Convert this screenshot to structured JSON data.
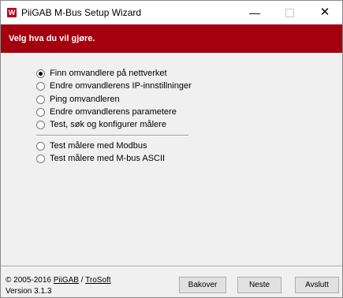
{
  "window": {
    "title": "PiiGAB M-Bus Setup Wizard",
    "app_icon_letter": "W",
    "minimize_glyph": "—",
    "close_glyph": "✕"
  },
  "banner": {
    "text": "Velg hva du vil gjøre.",
    "color": "#a5000e"
  },
  "options_group1": [
    {
      "label": "Finn omvandlere på nettverket",
      "selected": true
    },
    {
      "label": "Endre omvandlerens IP-innstillninger",
      "selected": false
    },
    {
      "label": "Ping omvandleren",
      "selected": false
    },
    {
      "label": "Endre omvandlerens parametere",
      "selected": false
    },
    {
      "label": "Test, søk og konfigurer målere",
      "selected": false
    }
  ],
  "options_group2": [
    {
      "label": "Test målere med Modbus",
      "selected": false
    },
    {
      "label": "Test målere med M-bus ASCII",
      "selected": false
    }
  ],
  "footer": {
    "copyright_prefix": "© 2005-2016",
    "link1": "PiiGAB",
    "link_sep": "/",
    "link2": "TroSoft",
    "version": "Version 3.1.3"
  },
  "buttons": {
    "back": "Bakover",
    "next": "Neste",
    "exit": "Avslutt"
  }
}
